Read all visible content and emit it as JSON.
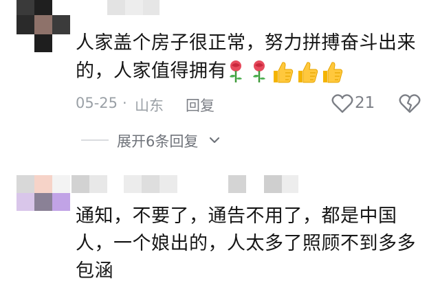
{
  "comments": [
    {
      "text_line1": "人家盖个房子很正常，努力拼搏奋斗出来",
      "text_line2": "的，人家值得拥有",
      "emojis": [
        "rose",
        "rose",
        "thumbs-up",
        "thumbs-up",
        "thumbs-up"
      ],
      "date": "05-25",
      "separator": "·",
      "location": "山东",
      "reply_label": "回复",
      "like_count": "21",
      "expand_label": "展开6条回复"
    },
    {
      "text_line1": "通知，不要了，通告不用了，都是中国",
      "text_line2": "人，一个娘出的，人太多了照顾不到多多",
      "text_line3": "包涵"
    }
  ],
  "colors": {
    "text": "#161616",
    "meta": "#9aa0a6",
    "action": "#7c7f86",
    "divider": "#d9dbdf"
  }
}
